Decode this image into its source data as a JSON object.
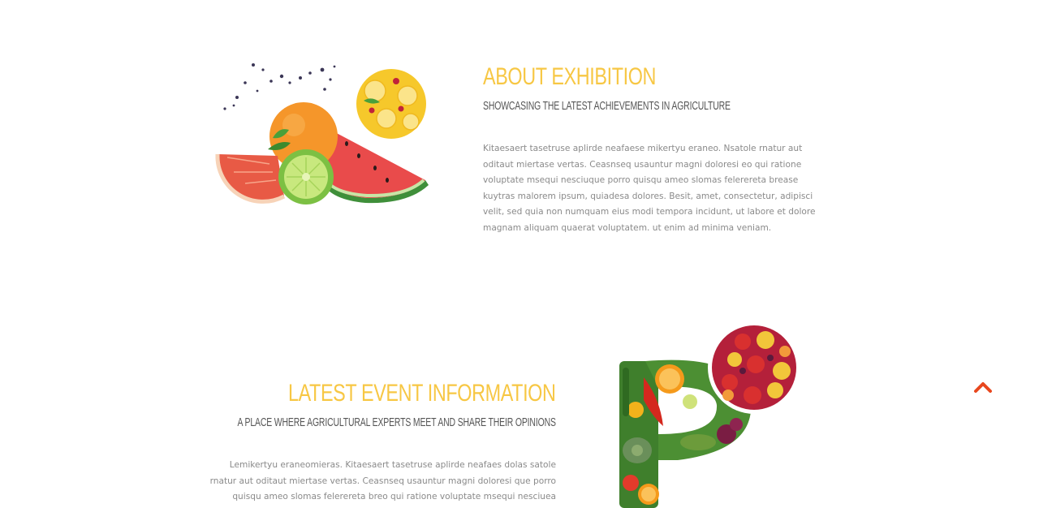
{
  "about": {
    "title": "ABOUT EXHIBITION",
    "subtitle": "SHOWCASING THE LATEST ACHIEVEMENTS IN AGRICULTURE",
    "text": "Kitaesaert tasetruse aplirde neafaese mikertyu eraneo. Nsatole rnatur aut oditaut miertase vertas. Ceasnseq usauntur magni doloresi eo qui ratione voluptate msequi nesciuque porro quisqu ameo slomas felerereta brease kuytras malorem ipsum, quiadesa dolores. Besit, amet, consectetur, adipisci velit, sed quia non numquam eius modi tempora incidunt, ut labore et dolore magnam aliquam quaerat voluptatem. ut enim ad minima veniam."
  },
  "event": {
    "title": "LATEST EVENT INFORMATION",
    "subtitle": "A PLACE WHERE AGRICULTURAL EXPERTS MEET AND SHARE THEIR OPINIONS",
    "text": "Lemikertyu eraneomieras. Kitaesaert tasetruse aplirde neafaes dolas satole rnatur aut oditaut miertase vertas. Ceasnseq usauntur magni doloresi que porro quisqu ameo slomas felerereta breo qui ratione voluptate msequi nesciuea rtuytasotytas quiadesa"
  },
  "icons": {
    "scroll_top": "chevron-up-icon",
    "fruit_illustration": "fruit-splash-illustration-icon",
    "vegetable_illustration": "vegetable-letter-p-illustration-icon"
  },
  "colors": {
    "accent_heading": "#f7c744",
    "subheading": "#555555",
    "body_text": "#8a8a8a",
    "scroll_top": "#e8471e"
  }
}
